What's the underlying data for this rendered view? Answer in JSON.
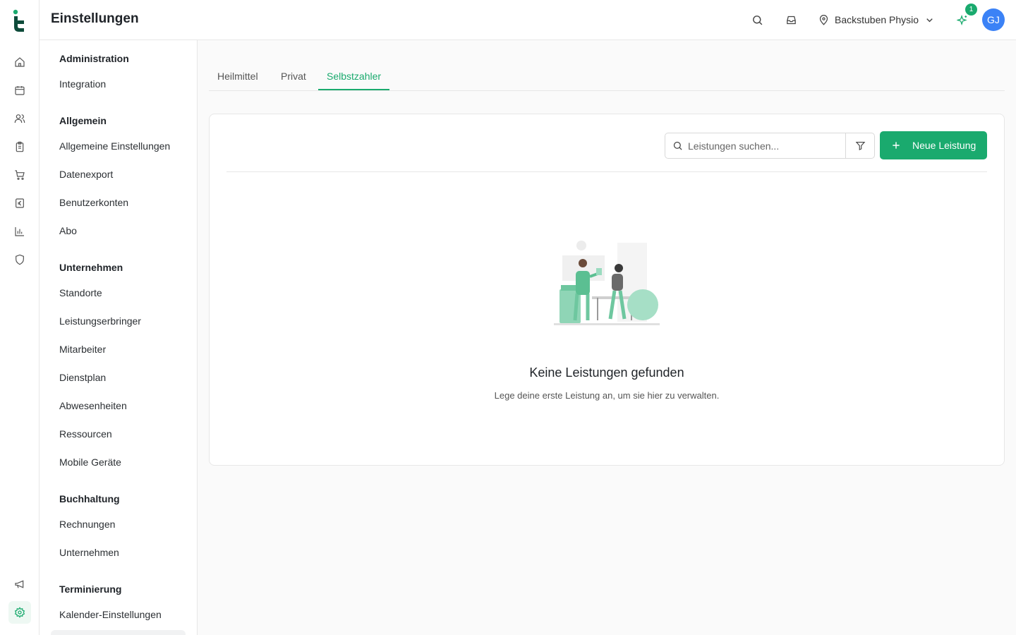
{
  "header": {
    "title": "Einstellungen",
    "location": "Backstuben Physio",
    "notification_count": "1",
    "avatar_initials": "GJ"
  },
  "rail": {
    "icons": [
      "home-icon",
      "calendar-icon",
      "users-icon",
      "clipboard-icon",
      "cart-icon",
      "euro-icon",
      "bar-chart-icon",
      "shield-icon",
      "megaphone-icon",
      "gear-icon"
    ],
    "active": "gear-icon"
  },
  "sidebar": {
    "sections": [
      {
        "title": "Administration",
        "items": [
          "Integration"
        ]
      },
      {
        "title": "Allgemein",
        "items": [
          "Allgemeine Einstellungen",
          "Datenexport",
          "Benutzerkonten",
          "Abo"
        ]
      },
      {
        "title": "Unternehmen",
        "items": [
          "Standorte",
          "Leistungserbringer",
          "Mitarbeiter",
          "Dienstplan",
          "Abwesenheiten",
          "Ressourcen",
          "Mobile Geräte"
        ]
      },
      {
        "title": "Buchhaltung",
        "items": [
          "Rechnungen",
          "Unternehmen"
        ]
      },
      {
        "title": "Terminierung",
        "items": [
          "Kalender-Einstellungen"
        ]
      }
    ]
  },
  "tabs": [
    {
      "label": "Heilmittel",
      "active": false
    },
    {
      "label": "Privat",
      "active": false
    },
    {
      "label": "Selbstzahler",
      "active": true
    }
  ],
  "toolbar": {
    "search_placeholder": "Leistungen suchen...",
    "new_button_label": "Neue Leistung"
  },
  "empty_state": {
    "title": "Keine Leistungen gefunden",
    "subtitle": "Lege deine erste Leistung an, um sie hier zu verwalten."
  },
  "colors": {
    "accent": "#1aaa6e",
    "avatar": "#3b82f6",
    "brand_dark": "#0e4b3a"
  }
}
